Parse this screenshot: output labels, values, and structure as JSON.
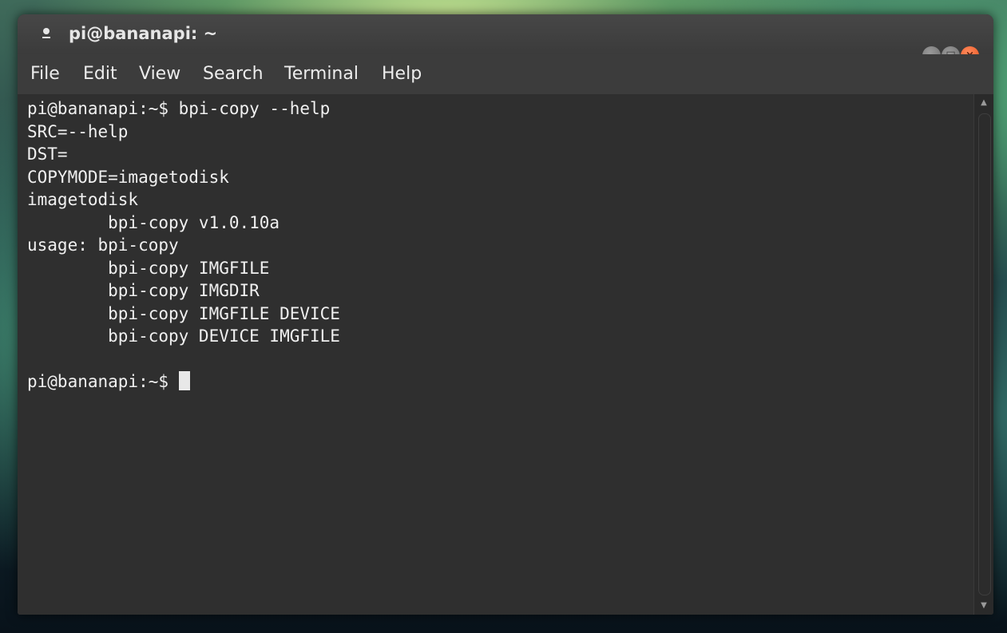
{
  "window": {
    "title": "pi@bananapi: ~",
    "controls": {
      "minimize_glyph": "−",
      "maximize_glyph": "□",
      "close_glyph": "×"
    }
  },
  "menu": {
    "file": "File",
    "edit": "Edit",
    "view": "View",
    "search": "Search",
    "terminal": "Terminal",
    "help": "Help"
  },
  "terminal": {
    "output": "pi@bananapi:~$ bpi-copy --help\nSRC=--help\nDST=\nCOPYMODE=imagetodisk\nimagetodisk\n        bpi-copy v1.0.10a\nusage: bpi-copy\n        bpi-copy IMGFILE\n        bpi-copy IMGDIR\n        bpi-copy IMGFILE DEVICE\n        bpi-copy DEVICE IMGFILE\n\n",
    "prompt": "pi@bananapi:~$ "
  },
  "scrollbar": {
    "up_glyph": "▲",
    "down_glyph": "▼"
  },
  "colors": {
    "terminal_bg": "#2f2f2f",
    "text": "#f0f0f0",
    "close_button": "#e9541f"
  },
  "icons": {
    "title": "terminal-icon"
  }
}
